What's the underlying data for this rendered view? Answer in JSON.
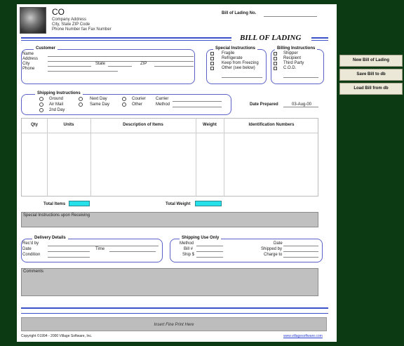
{
  "company": {
    "name": "CO",
    "address_line": "Company Address",
    "city_line": "City, State ZIP Code",
    "phone_line": "Phone Number fax Fax Number"
  },
  "header": {
    "bol_no_label": "Bill of Lading No.",
    "title": "BILL OF LADING"
  },
  "customer": {
    "title": "Customer",
    "name_label": "Name",
    "address_label": "Address",
    "city_label": "City",
    "state_label": "State",
    "zip_label": "ZIP",
    "phone_label": "Phone"
  },
  "special": {
    "title": "Special Instructions",
    "items": [
      "Fragile",
      "Refrigerate",
      "Keep from Freezing",
      "Other (see below)"
    ]
  },
  "billing": {
    "title": "Billing Instructions",
    "items": [
      "Shipper",
      "Recipient",
      "Third Party",
      "C.O.D."
    ]
  },
  "shipping": {
    "title": "Shipping Instructions",
    "col1": [
      "Ground",
      "Air Mail",
      "2nd Day"
    ],
    "col2": [
      "Next Day",
      "Same Day"
    ],
    "col3": [
      "Courier",
      "Other"
    ],
    "carrier_label": "Carrier",
    "method_label": "Method"
  },
  "date_prepared": {
    "label": "Date Prepared",
    "value": "03-Aug-00"
  },
  "table": {
    "headers": [
      "Qty",
      "Units",
      "Description of Items",
      "Weight",
      "Identification Numbers"
    ]
  },
  "totals": {
    "items_label": "Total Items",
    "weight_label": "Total Weight"
  },
  "special_receiving": {
    "label": "Special Instructions upon Receiving"
  },
  "delivery": {
    "title": "Delivery Details",
    "recd_label": "Rec'd by",
    "date_label": "Date",
    "time_label": "Time",
    "condition_label": "Condition"
  },
  "shipping_use": {
    "title": "Shipping Use Only",
    "method_label": "Method",
    "bill_label": "Bill #",
    "ship_label": "Ship $",
    "date_label": "Date",
    "shipped_by_label": "Shipped by",
    "charge_to_label": "Charge to"
  },
  "comments": {
    "label": "Comments"
  },
  "footer": {
    "fine_print": "Insert Fine Print Here",
    "copyright": "Copyright ©1994 - 2000 Village Software, Inc.",
    "website": "www.villagesoftware.com"
  },
  "sidebar": {
    "new_label": "New Bill of Lading",
    "save_label": "Save Bill to db",
    "load_label": "Load Bill from db"
  },
  "colors": {
    "background": "#0c3a12",
    "accent_blue": "#3a52c8",
    "field_cyan": "#26e0ea",
    "gray_panel": "#c0c0c0"
  }
}
